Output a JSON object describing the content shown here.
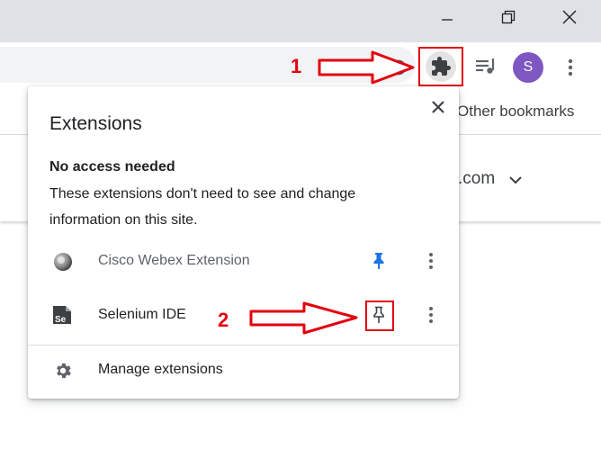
{
  "toolbar": {
    "profile_initial": "S",
    "other_bookmarks": "Other bookmarks",
    "page_domain": ".com"
  },
  "popup": {
    "title": "Extensions",
    "section_heading": "No access needed",
    "section_desc_line1": "These extensions don't need to see and change",
    "section_desc_line2": "information on this site.",
    "extensions": [
      {
        "name": "Cisco Webex Extension",
        "pinned": true,
        "icon": "webex-icon"
      },
      {
        "name": "Selenium IDE",
        "pinned": false,
        "icon": "selenium-icon"
      }
    ],
    "manage_label": "Manage extensions"
  },
  "annotations": {
    "step1": "1",
    "step2": "2",
    "color": "#e3000f"
  },
  "colors": {
    "accent_pin": "#1a73e8",
    "avatar": "#7e57c2",
    "titlebar": "#dee1e6"
  }
}
